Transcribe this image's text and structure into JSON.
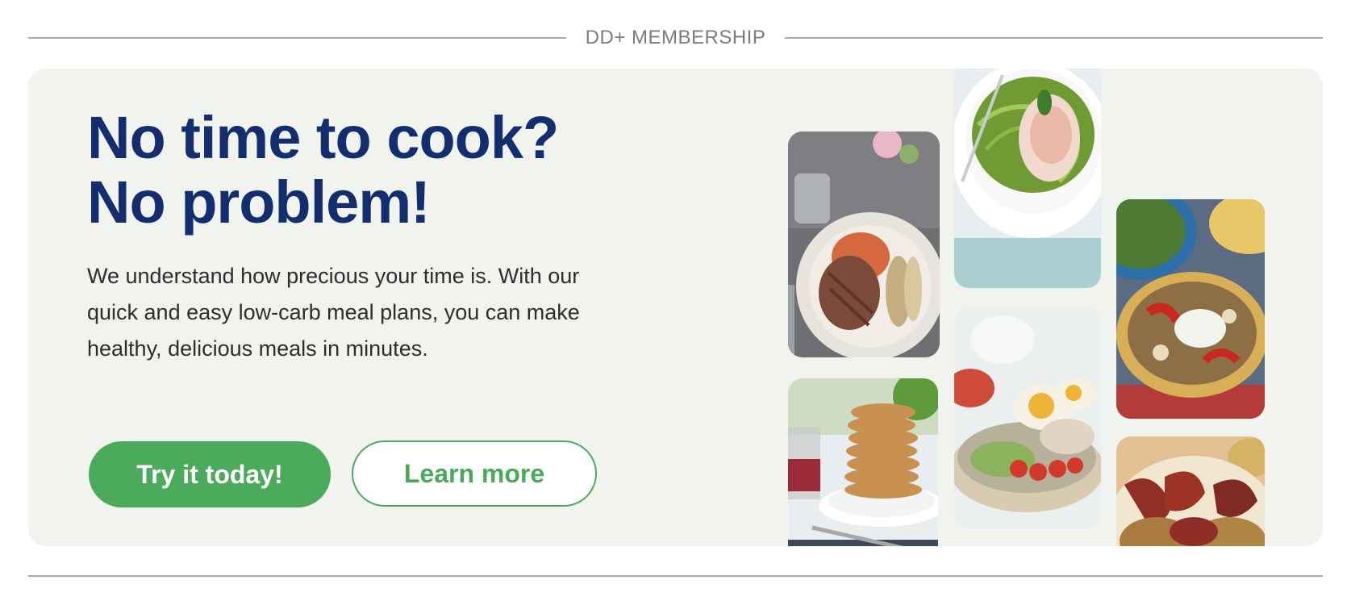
{
  "section": {
    "label": "DD+ MEMBERSHIP"
  },
  "promo": {
    "headline_line1": "No time to cook?",
    "headline_line2": "No problem!",
    "body": "We understand how precious your time is. With our quick and easy low-carb meal plans, you can make healthy, delicious meals in minutes.",
    "primary_button": "Try it today!",
    "secondary_button": "Learn more"
  },
  "images": [
    {
      "name": "steak-plate-image"
    },
    {
      "name": "zucchini-noodles-salmon-image"
    },
    {
      "name": "chicken-pepper-bowl-image"
    },
    {
      "name": "pancake-stack-image"
    },
    {
      "name": "egg-salad-bowl-image"
    },
    {
      "name": "bacon-fritters-image"
    }
  ],
  "colors": {
    "headline": "#142d6e",
    "accent_green": "#4caa5c",
    "card_background": "#f0f3ee"
  }
}
